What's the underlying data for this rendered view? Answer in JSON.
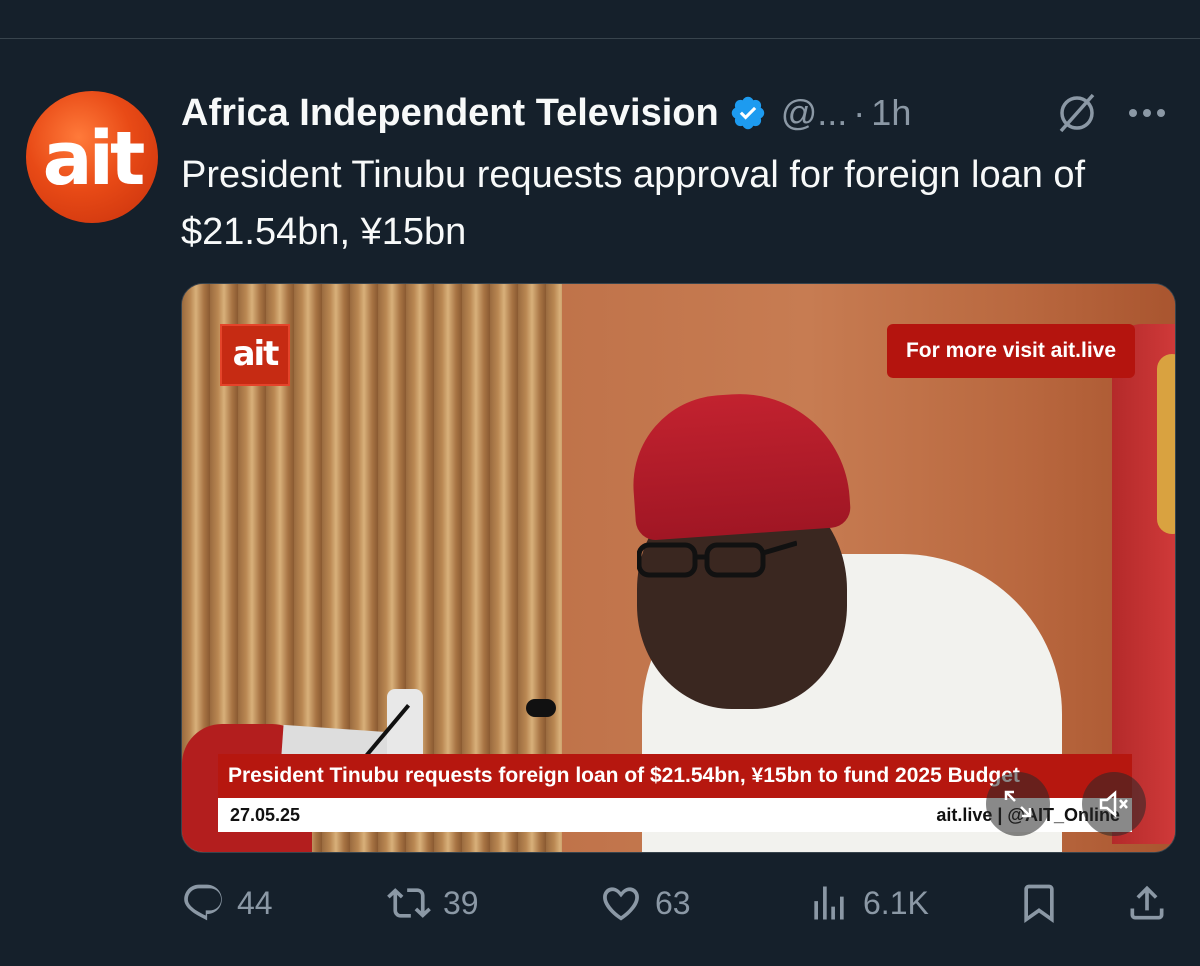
{
  "tweet": {
    "author_name": "Africa Independent Television",
    "handle": "@...",
    "separator": "·",
    "time": "1h",
    "text": "President Tinubu requests approval for foreign loan of $21.54bn, ¥15bn",
    "avatar_text": "ait"
  },
  "media": {
    "logo_text": "ait",
    "visit_badge": "For more visit ait.live",
    "headline_banner": "President Tinubu requests foreign loan of $21.54bn, ¥15bn to fund 2025 Budget",
    "date": "27.05.25",
    "source": "ait.live | @AIT_Online"
  },
  "actions": {
    "replies": "44",
    "reposts": "39",
    "likes": "63",
    "views": "6.1K"
  },
  "icons": {
    "verified": "verified-badge-icon",
    "grok": "grok-icon",
    "more": "more-dots-icon",
    "expand": "expand-icon",
    "mute": "mute-icon",
    "reply": "reply-icon",
    "repost": "repost-icon",
    "like": "heart-icon",
    "views": "views-chart-icon",
    "bookmark": "bookmark-icon",
    "share": "share-icon"
  },
  "colors": {
    "background": "#15202b",
    "secondary_text": "#8b98a5",
    "verified_blue": "#1d9bf0",
    "ait_red": "#b6170f"
  }
}
